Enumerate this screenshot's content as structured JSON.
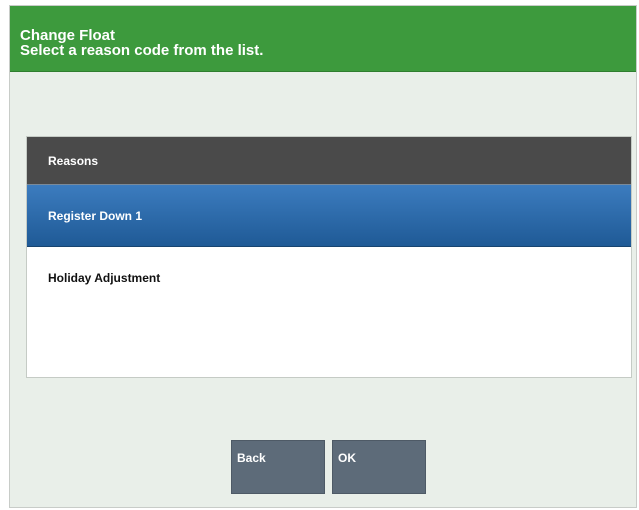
{
  "header": {
    "title": "Change Float",
    "subtitle": "Select a reason code from the list."
  },
  "list": {
    "header": "Reasons",
    "items": [
      {
        "label": "Register Down 1",
        "selected": true
      },
      {
        "label": "Holiday Adjustment",
        "selected": false
      }
    ]
  },
  "buttons": {
    "back": "Back",
    "ok": "OK"
  },
  "colors": {
    "header_bg": "#3d9a3d",
    "selected_row": "#2a6aab",
    "button_bg": "#5d6b79",
    "list_header_bg": "#4a4a4a"
  }
}
